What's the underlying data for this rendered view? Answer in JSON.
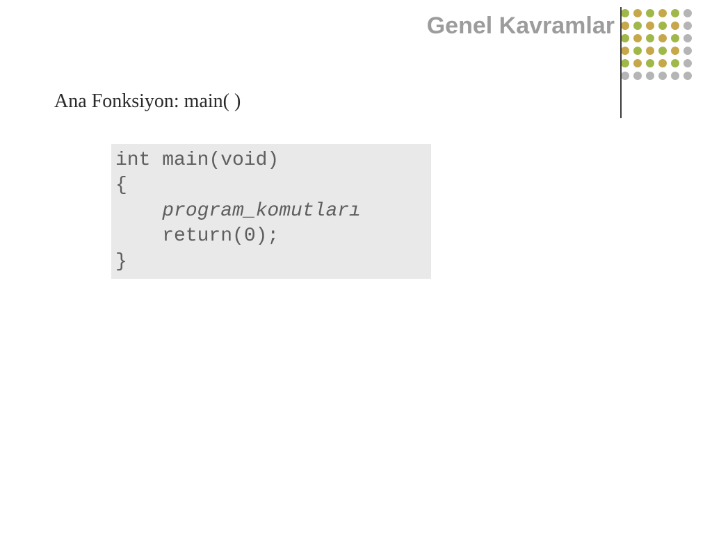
{
  "header": {
    "title": "Genel Kavramlar"
  },
  "subtitle": "Ana Fonksiyon: main( )",
  "code": {
    "line1": "int main(void)",
    "line2": "{",
    "line3": "    program_komutları",
    "line4": "    return(0);",
    "line5": "}"
  },
  "decoration": {
    "dots": {
      "rows": 6,
      "cols": 6,
      "colors": {
        "green": "#a0b84a",
        "gold": "#c6a84a",
        "gray": "#b5b5b5"
      }
    }
  }
}
